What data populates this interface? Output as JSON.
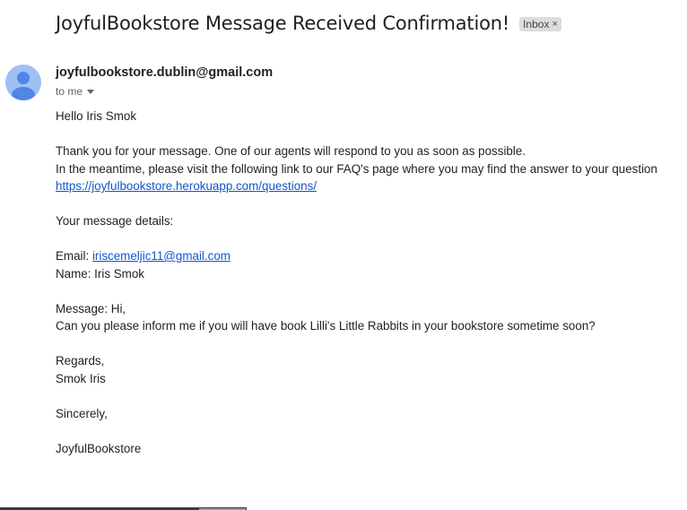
{
  "email": {
    "subject": "JoyfulBookstore Message Received Confirmation!",
    "label": "Inbox",
    "label_remove": "×",
    "avatar_icon": "person-icon",
    "sender": "joyfulbookstore.dublin@gmail.com",
    "recipient": "to me",
    "body": {
      "greeting": "Hello Iris Smok",
      "thanks": "Thank you for your message. One of our agents will respond to you as soon as possible.",
      "faq_text": "In the meantime, please visit the following link to our FAQ's page where you may find the answer to your question",
      "faq_link": "https://joyfulbookstore.herokuapp.com/questions/",
      "details_heading": "Your message details:",
      "email_label": "Email: ",
      "email_value": "iriscemeljic11@gmail.com",
      "name_line": "Name: Iris Smok",
      "message_label": "Message:  Hi,",
      "message_text": "Can you please inform me if you will have book Lilli's Little Rabbits in your bookstore sometime soon?",
      "regards": "Regards,",
      "regards_name": "Smok Iris",
      "sincerely": "Sincerely,",
      "signature": "JoyfulBookstore"
    }
  },
  "colors": {
    "link": "#1155cc",
    "avatar_bg": "#9fc0f3",
    "avatar_fg": "#4f86e8",
    "chip_bg": "#dddddd"
  }
}
